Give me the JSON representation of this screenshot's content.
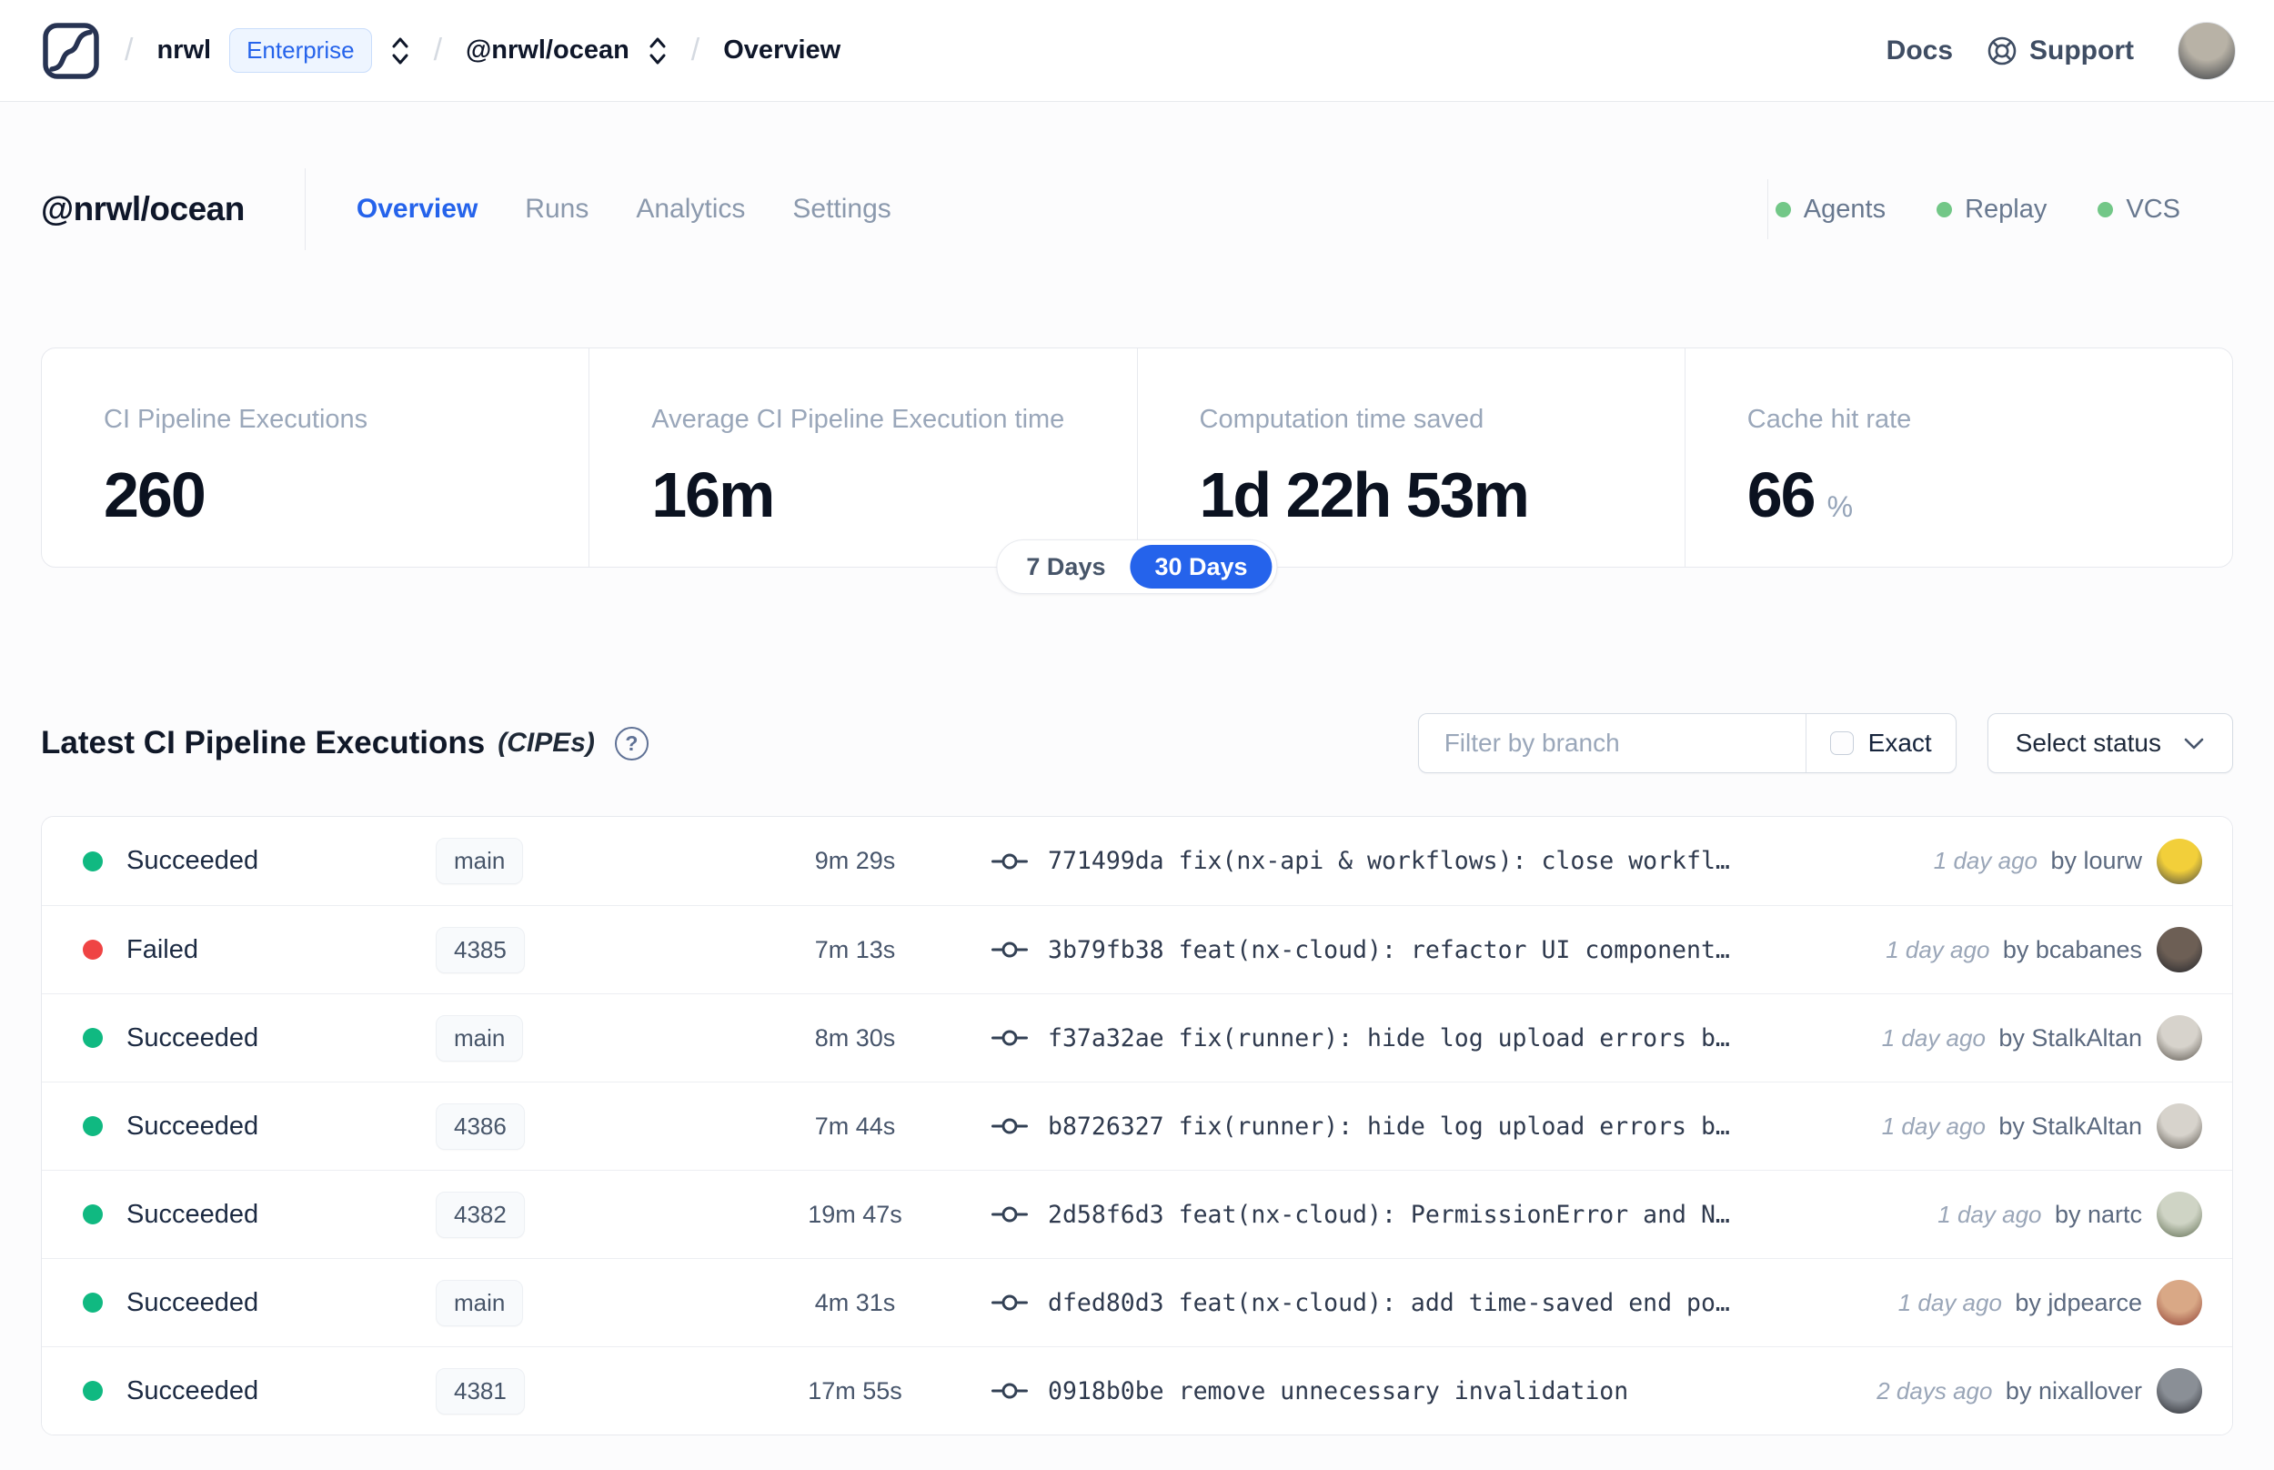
{
  "nav": {
    "breadcrumb": {
      "org": "nrwl",
      "org_badge": "Enterprise",
      "workspace": "@nrwl/ocean",
      "page": "Overview",
      "separator": "/"
    },
    "docs_label": "Docs",
    "support_label": "Support",
    "avatar_colors": [
      "#b8b2a6",
      "#383c42"
    ]
  },
  "header": {
    "title": "@nrwl/ocean",
    "tabs": [
      {
        "label": "Overview",
        "active": true
      },
      {
        "label": "Runs",
        "active": false
      },
      {
        "label": "Analytics",
        "active": false
      },
      {
        "label": "Settings",
        "active": false
      }
    ],
    "indicators": [
      {
        "label": "Agents",
        "color": "#72c787"
      },
      {
        "label": "Replay",
        "color": "#72c787"
      },
      {
        "label": "VCS",
        "color": "#72c787"
      }
    ]
  },
  "stats": {
    "cards": [
      {
        "label": "CI Pipeline Executions",
        "value": "260",
        "suffix": ""
      },
      {
        "label": "Average CI Pipeline Execution time",
        "value": "16m",
        "suffix": ""
      },
      {
        "label": "Computation time saved",
        "value": "1d 22h 53m",
        "suffix": ""
      },
      {
        "label": "Cache hit rate",
        "value": "66",
        "suffix": "%"
      }
    ],
    "range_toggle": {
      "options": [
        "7 Days",
        "30 Days"
      ],
      "selected": "30 Days"
    }
  },
  "cipe_section": {
    "title": "Latest CI Pipeline Executions",
    "title_suffix": "(CIPEs)",
    "help_glyph": "?",
    "filter": {
      "placeholder": "Filter by branch",
      "exact_label": "Exact",
      "exact_checked": false
    },
    "status_select_label": "Select status",
    "rows": [
      {
        "status": "Succeeded",
        "status_color": "#10b981",
        "branch": "main",
        "duration": "9m 29s",
        "commit_hash": "771499da",
        "commit_message": "fix(nx-api & workflows): close workfl…",
        "time": "1 day ago",
        "author": "by lourw",
        "avatar_colors": [
          "#f2cf3a",
          "#4a4a42"
        ]
      },
      {
        "status": "Failed",
        "status_color": "#ef4444",
        "branch": "4385",
        "duration": "7m 13s",
        "commit_hash": "3b79fb38",
        "commit_message": "feat(nx-cloud): refactor UI component…",
        "time": "1 day ago",
        "author": "by bcabanes",
        "avatar_colors": [
          "#6d5f55",
          "#23252b"
        ]
      },
      {
        "status": "Succeeded",
        "status_color": "#10b981",
        "branch": "main",
        "duration": "8m 30s",
        "commit_hash": "f37a32ae",
        "commit_message": "fix(runner): hide log upload errors b…",
        "time": "1 day ago",
        "author": "by StalkAltan",
        "avatar_colors": [
          "#d7d3cc",
          "#57524a"
        ]
      },
      {
        "status": "Succeeded",
        "status_color": "#10b981",
        "branch": "4386",
        "duration": "7m 44s",
        "commit_hash": "b8726327",
        "commit_message": "fix(runner): hide log upload errors b…",
        "time": "1 day ago",
        "author": "by StalkAltan",
        "avatar_colors": [
          "#d7d3cc",
          "#57524a"
        ]
      },
      {
        "status": "Succeeded",
        "status_color": "#10b981",
        "branch": "4382",
        "duration": "19m 47s",
        "commit_hash": "2d58f6d3",
        "commit_message": "feat(nx-cloud): PermissionError and N…",
        "time": "1 day ago",
        "author": "by nartc",
        "avatar_colors": [
          "#cfd4c5",
          "#5d6b4f"
        ]
      },
      {
        "status": "Succeeded",
        "status_color": "#10b981",
        "branch": "main",
        "duration": "4m 31s",
        "commit_hash": "dfed80d3",
        "commit_message": "feat(nx-cloud): add time-saved end po…",
        "time": "1 day ago",
        "author": "by jdpearce",
        "avatar_colors": [
          "#d9a886",
          "#8c3b30"
        ]
      },
      {
        "status": "Succeeded",
        "status_color": "#10b981",
        "branch": "4381",
        "duration": "17m 55s",
        "commit_hash": "0918b0be",
        "commit_message": "remove unnecessary invalidation",
        "time": "2 days ago",
        "author": "by nixallover",
        "avatar_colors": [
          "#8a8f96",
          "#26282e"
        ]
      }
    ]
  },
  "colors": {
    "accent_blue": "#2563eb",
    "success_green": "#10b981",
    "failure_red": "#ef4444",
    "indicator_green": "#72c787"
  }
}
